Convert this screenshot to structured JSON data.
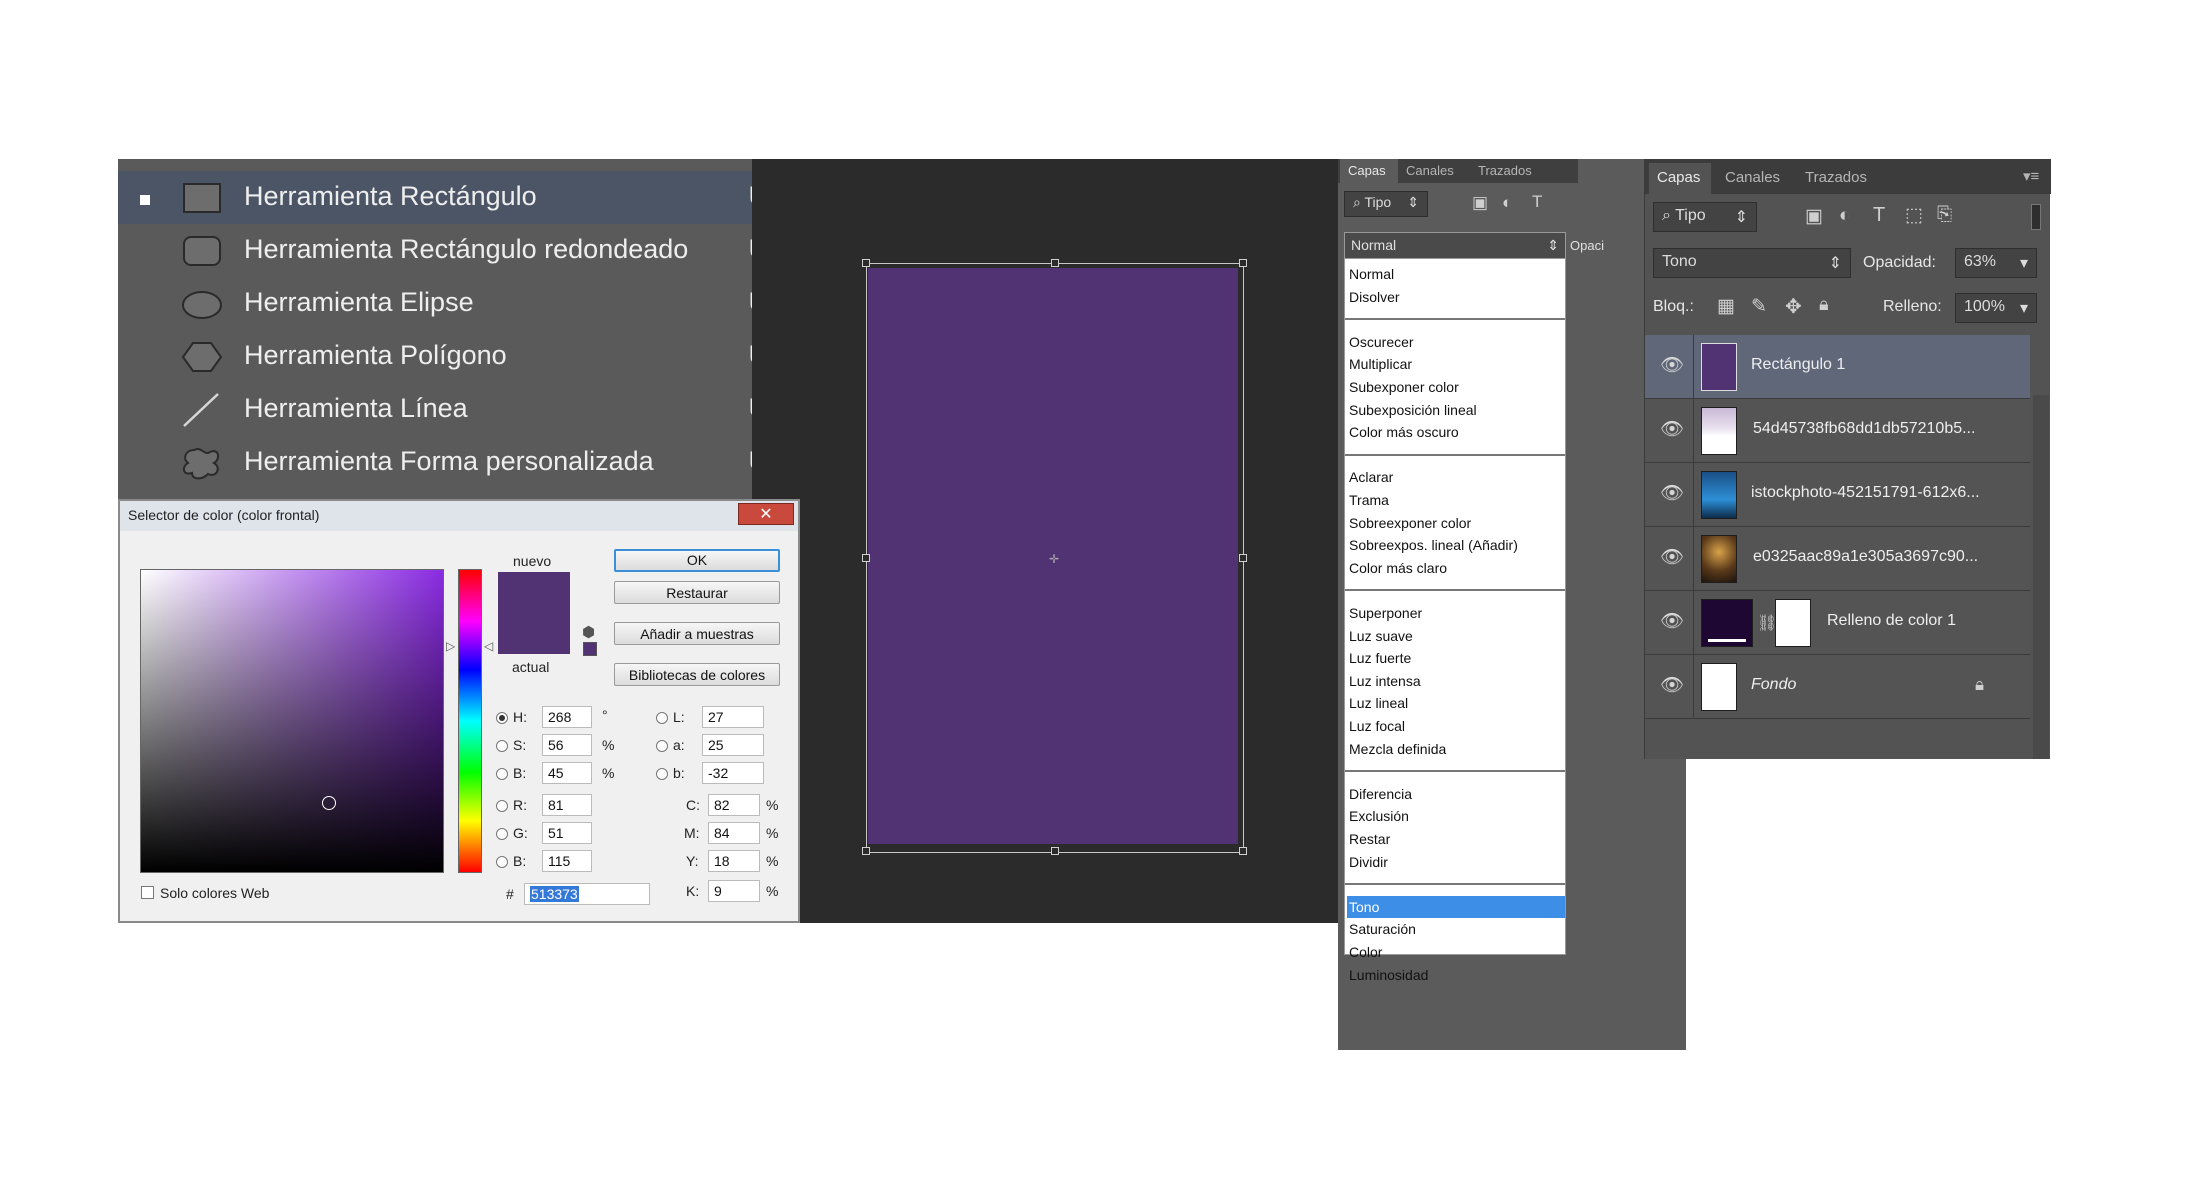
{
  "tools_flyout": {
    "items": [
      {
        "label": "Herramienta Rectángulo",
        "key": "U",
        "selected": true
      },
      {
        "label": "Herramienta Rectángulo redondeado",
        "key": "U",
        "selected": false
      },
      {
        "label": "Herramienta Elipse",
        "key": "U",
        "selected": false
      },
      {
        "label": "Herramienta Polígono",
        "key": "U",
        "selected": false
      },
      {
        "label": "Herramienta Línea",
        "key": "U",
        "selected": false
      },
      {
        "label": "Herramienta Forma personalizada",
        "key": "U",
        "selected": false
      }
    ]
  },
  "canvas": {
    "shape_fill": "#513373"
  },
  "color_picker": {
    "title": "Selector de color (color frontal)",
    "close_glyph": "✕",
    "new_label": "nuevo",
    "current_label": "actual",
    "buttons": {
      "ok": "OK",
      "reset": "Restaurar",
      "add_to_swatches": "Añadir a muestras",
      "color_libraries": "Bibliotecas de colores"
    },
    "fields": {
      "H": {
        "label": "H:",
        "value": "268",
        "unit": "°"
      },
      "S": {
        "label": "S:",
        "value": "56",
        "unit": "%"
      },
      "Bv": {
        "label": "B:",
        "value": "45",
        "unit": "%"
      },
      "R": {
        "label": "R:",
        "value": "81"
      },
      "G": {
        "label": "G:",
        "value": "51"
      },
      "Bc": {
        "label": "B:",
        "value": "115"
      },
      "L": {
        "label": "L:",
        "value": "27"
      },
      "a": {
        "label": "a:",
        "value": "25"
      },
      "b": {
        "label": "b:",
        "value": "-32"
      },
      "C": {
        "label": "C:",
        "value": "82",
        "unit": "%"
      },
      "M": {
        "label": "M:",
        "value": "84",
        "unit": "%"
      },
      "Y": {
        "label": "Y:",
        "value": "18",
        "unit": "%"
      },
      "K": {
        "label": "K:",
        "value": "9",
        "unit": "%"
      }
    },
    "hex_label": "#",
    "hex_value": "513373",
    "web_only_label": "Solo colores Web",
    "new_color": "#513373",
    "current_color": "#513373"
  },
  "blend_panel": {
    "tabs": [
      "Capas",
      "Canales",
      "Trazados"
    ],
    "filter_label": "Tipo",
    "current_mode": "Normal",
    "opacity_label": "Opaci",
    "groups": [
      [
        "Normal",
        "Disolver"
      ],
      [
        "Oscurecer",
        "Multiplicar",
        "Subexponer color",
        "Subexposición lineal",
        "Color más oscuro"
      ],
      [
        "Aclarar",
        "Trama",
        "Sobreexponer color",
        "Sobreexpos. lineal (Añadir)",
        "Color más claro"
      ],
      [
        "Superponer",
        "Luz suave",
        "Luz fuerte",
        "Luz intensa",
        "Luz lineal",
        "Luz focal",
        "Mezcla definida"
      ],
      [
        "Diferencia",
        "Exclusión",
        "Restar",
        "Dividir"
      ],
      [
        "Tono",
        "Saturación",
        "Color",
        "Luminosidad"
      ]
    ],
    "selected_mode": "Tono"
  },
  "layers_panel": {
    "tabs": [
      "Capas",
      "Canales",
      "Trazados"
    ],
    "filter_label": "Tipo",
    "blend_mode": "Tono",
    "opacity_label": "Opacidad:",
    "opacity_value": "63%",
    "lock_label": "Bloq.:",
    "fill_label": "Relleno:",
    "fill_value": "100%",
    "layers": [
      {
        "name": "Rectángulo 1",
        "selected": true
      },
      {
        "name": "54d45738fb68dd1db57210b5..."
      },
      {
        "name": "istockphoto-452151791-612x6..."
      },
      {
        "name": "e0325aac89a1e305a3697c90..."
      },
      {
        "name": "Relleno de color 1"
      },
      {
        "name": "Fondo",
        "italic": true,
        "locked": true
      }
    ]
  },
  "icons": {
    "tools": [
      "rectangle-icon",
      "rounded-rectangle-icon",
      "ellipse-icon",
      "polygon-icon",
      "line-icon",
      "custom-shape-icon"
    ],
    "layers": [
      "eye-icon",
      "lock-icon",
      "chain-link-icon",
      "panel-menu-icon"
    ]
  }
}
